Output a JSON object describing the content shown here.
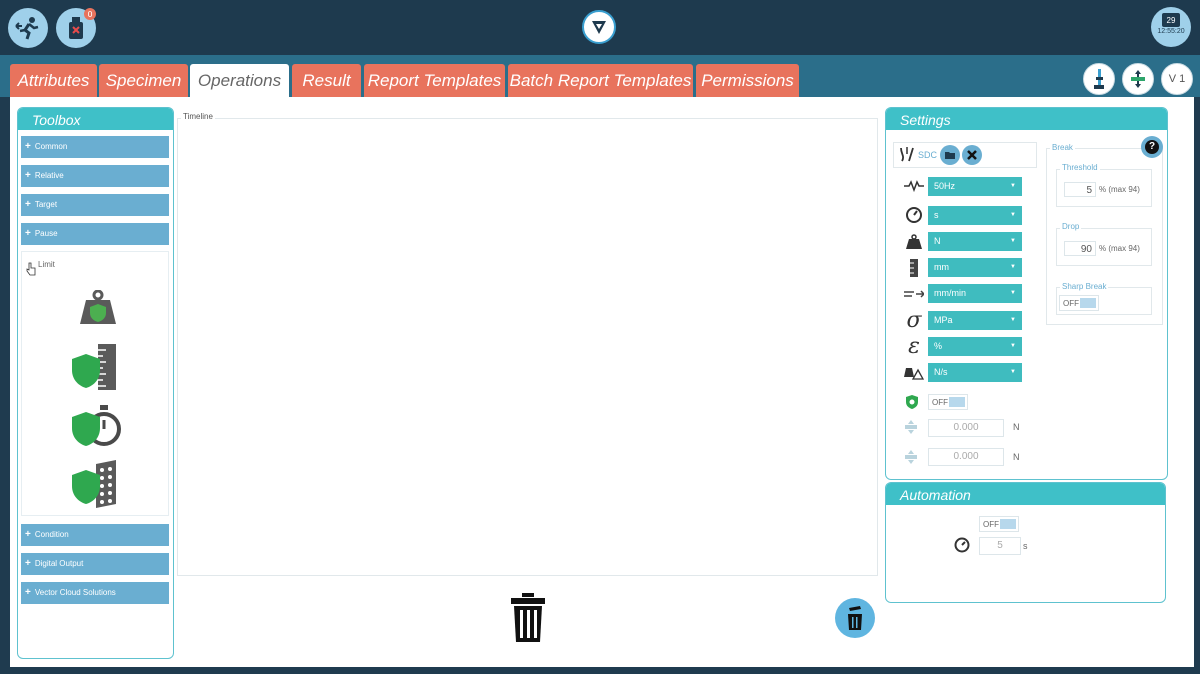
{
  "topbar": {
    "exit_icon": "exit-running-icon",
    "usb_icon": "usb-drive-icon",
    "usb_badge": "0",
    "logo_icon": "v-logo-icon",
    "calendar_day": "29",
    "clock_time": "12:55:20"
  },
  "tabs": [
    {
      "label": "Attributes"
    },
    {
      "label": "Specimen"
    },
    {
      "label": "Operations"
    },
    {
      "label": "Result"
    },
    {
      "label": "Report Templates"
    },
    {
      "label": "Batch Report Templates"
    },
    {
      "label": "Permissions"
    }
  ],
  "active_tab": "Operations",
  "top_right": {
    "version": "V 1"
  },
  "toolbox": {
    "title": "Toolbox",
    "items_top": [
      {
        "label": "Common"
      },
      {
        "label": "Relative"
      },
      {
        "label": "Target"
      },
      {
        "label": "Pause"
      }
    ],
    "limit": {
      "label": "Limit",
      "icons": [
        "load-limit-icon",
        "displacement-limit-icon",
        "time-limit-icon",
        "strain-limit-icon"
      ]
    },
    "items_bottom": [
      {
        "label": "Condition"
      },
      {
        "label": "Digital Output"
      },
      {
        "label": "Vector Cloud Solutions"
      }
    ]
  },
  "timeline": {
    "label": "Timeline"
  },
  "settings": {
    "title": "Settings",
    "sdc_label": "SDC",
    "selects": [
      {
        "value": "50Hz"
      },
      {
        "value": "s"
      },
      {
        "value": "N"
      },
      {
        "value": "mm"
      },
      {
        "value": "mm/min"
      },
      {
        "value": "MPa"
      },
      {
        "value": "%"
      },
      {
        "value": "N/s"
      }
    ],
    "limit_toggle": "OFF",
    "field_1": "0.000",
    "field_2": "0.000",
    "unit_1": "N",
    "unit_2": "N",
    "break": {
      "label": "Break",
      "threshold_label": "Threshold",
      "threshold_value": "5",
      "threshold_unit": "% (max 94)",
      "drop_label": "Drop",
      "drop_value": "90",
      "drop_unit": "% (max 94)",
      "sharp_label": "Sharp Break",
      "sharp_toggle": "OFF"
    }
  },
  "automation": {
    "title": "Automation",
    "toggle": "OFF",
    "time_value": "5",
    "time_unit": "s"
  },
  "colors": {
    "tab": "#e8735d",
    "teal": "#3fc0c8",
    "tool_blue": "#6aaed1",
    "dark_bg": "#1e3a4e"
  }
}
